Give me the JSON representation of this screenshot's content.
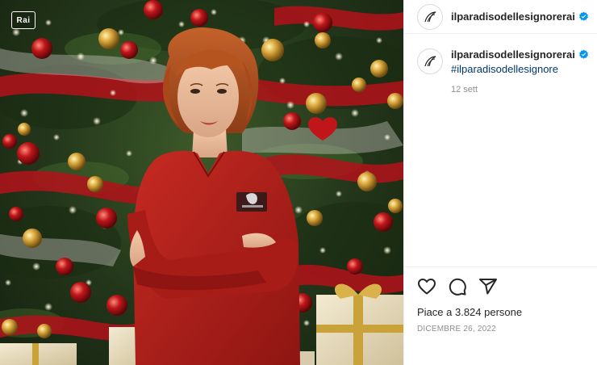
{
  "photo": {
    "channel_logo": "Rai",
    "description_icon": "christmas-tree-photo"
  },
  "post": {
    "username": "ilparadisodellesignorerai",
    "verified": true,
    "caption_hashtag": "#ilparadisodellesignore",
    "caption_time": "12 sett",
    "likes_text": "Piace a 3.824 persone",
    "date": "DICEMBRE 26, 2022"
  },
  "icons": {
    "like": "heart-icon",
    "comment": "comment-icon",
    "share": "share-icon",
    "verified": "verified-badge-icon"
  },
  "colors": {
    "verified_blue": "#0095f6",
    "hashtag_blue": "#00376b",
    "muted_gray": "#8e8e8e",
    "dress_red": "#b0201c"
  }
}
